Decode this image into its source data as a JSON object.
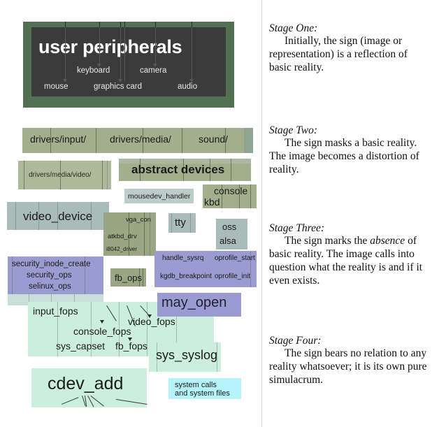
{
  "title": "Baudrillard simulacra stages — Linux kernel map",
  "top_panel": {
    "heading": "user peripherals",
    "frame_color": "#527153",
    "inner_color": "#3b3b3b",
    "labels": [
      {
        "text": "keyboard"
      },
      {
        "text": "camera"
      },
      {
        "text": "mouse"
      },
      {
        "text": "graphics card"
      },
      {
        "text": "audio"
      }
    ]
  },
  "subsystem_bar": {
    "items": [
      "drivers/input/",
      "drivers/media/",
      "sound/"
    ]
  },
  "boxes": {
    "drivers_media_video": "drivers/media/video/",
    "abstract_devices": "abstract devices",
    "mousedev_handler": "mousedev_handler",
    "console": "console",
    "kbd": "kbd",
    "video_device": "video_device",
    "vga_con": "vga_con",
    "atkbd_drv": "atkbd_drv",
    "i8042_driver": "i8042_driver",
    "tty": "tty",
    "oss": "oss",
    "alsa": "alsa",
    "security_inode_create": "security_inode_create",
    "security_ops": "security_ops",
    "selinux_ops": "selinux_ops",
    "fb_ops": "fb_ops",
    "handle_sysrq": "handle_sysrq",
    "oprofile_start": "oprofile_start",
    "kgdb_breakpoint": "kgdb_breakpoint",
    "oprofile_init": "oprofile_init",
    "may_open": "may_open",
    "input_fops": "input_fops",
    "console_fops": "console_fops",
    "video_fops": "video_fops",
    "sys_capset": "sys_capset",
    "fb_fops": "fb_fops",
    "sys_syslog": "sys_syslog",
    "cdev_add": "cdev_add",
    "legend_line1": "system calls",
    "legend_line2": "and system files"
  },
  "stages": [
    {
      "heading": "Stage One:",
      "body_pre": "Initially, the sign (image or representation) is a reflection of basic reality.",
      "body_em": "",
      "body_post": ""
    },
    {
      "heading": "Stage Two:",
      "body_pre": "The sign masks a basic reality. The image becomes a distortion of reality.",
      "body_em": "",
      "body_post": ""
    },
    {
      "heading": "Stage Three:",
      "body_pre": "The sign marks the ",
      "body_em": "absence",
      "body_post": " of basic reality. The image calls into question what the reality is and if it even exists."
    },
    {
      "heading": "Stage Four:",
      "body_pre": "The sign bears no relation to any reality whatsoever; it is its own pure simulacrum.",
      "body_em": "",
      "body_post": ""
    }
  ],
  "colors": {
    "olive": "#a3ae8d",
    "slate": "#a9bcb9",
    "purple": "#9a9bd0",
    "mint": "#cbeede",
    "cyan": "#b4f4fa",
    "frame_green": "#527153",
    "panel_dark": "#3b3b3b"
  }
}
